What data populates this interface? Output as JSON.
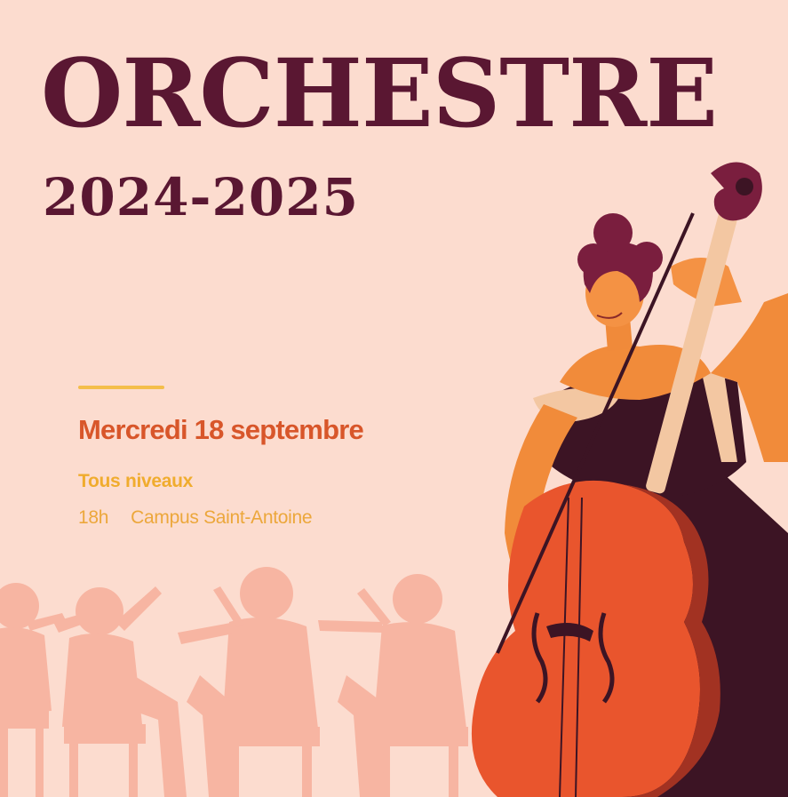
{
  "poster": {
    "title": "ORCHESTRE",
    "season": "2024-2025",
    "date": "Mercredi 18 septembre",
    "level": "Tous niveaux",
    "time": "18h",
    "venue": "Campus Saint-Antoine"
  },
  "colors": {
    "background": "#fcdccf",
    "title": "#5a1732",
    "date": "#d8562a",
    "level": "#f0ac2e",
    "accent_line": "#f4be4a",
    "silhouettes": "#f7b5a2",
    "cello": "#e9552d"
  },
  "illustration": {
    "main": "cellist-woman-illustration",
    "background": "orchestra-musicians-silhouettes"
  }
}
